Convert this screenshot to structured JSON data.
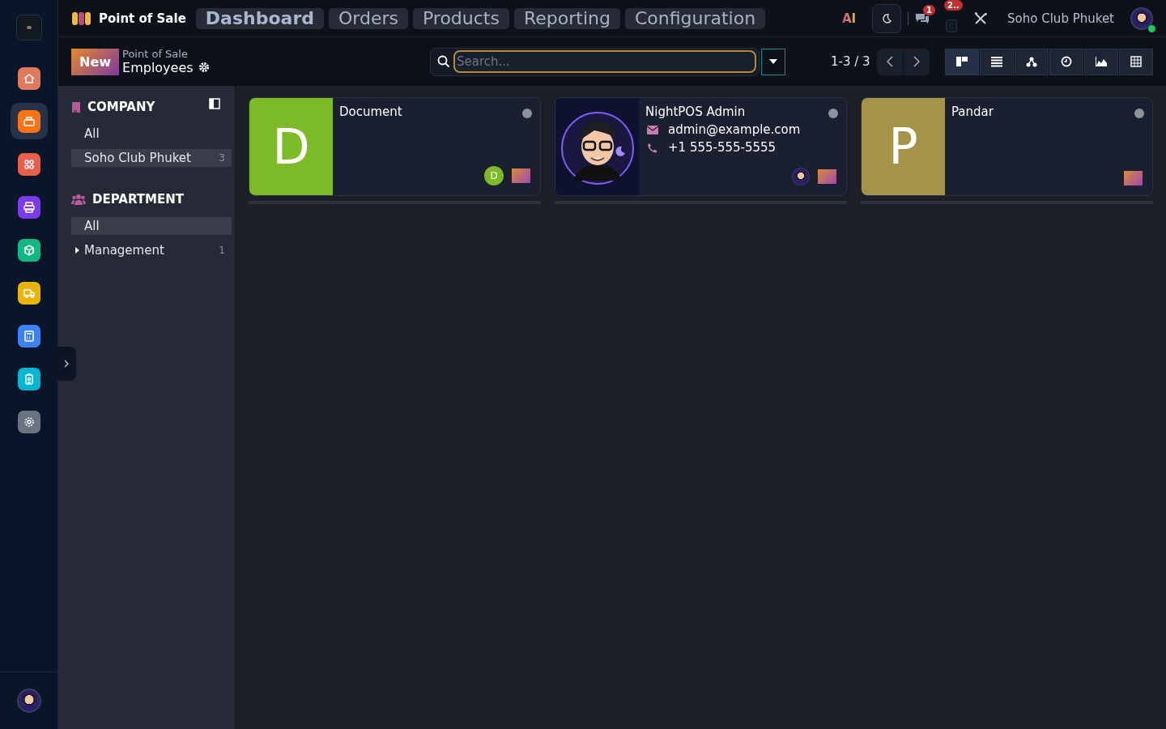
{
  "app_rail": [
    {
      "color": "#e07a5f",
      "selected": false
    },
    {
      "color": "#f97316",
      "selected": true
    },
    {
      "color": "#e8604c",
      "selected": false
    },
    {
      "color": "#7c3aed",
      "selected": false
    },
    {
      "color": "#10b981",
      "selected": false
    },
    {
      "color": "#eab308",
      "selected": false
    },
    {
      "color": "#3b82f6",
      "selected": false
    },
    {
      "color": "#06b6d4",
      "selected": false
    },
    {
      "color": "#6b7280",
      "selected": false
    }
  ],
  "top_bar": {
    "app_name": "Point of Sale",
    "menu": [
      {
        "label": "Dashboard",
        "selected": true
      },
      {
        "label": "Orders",
        "selected": false
      },
      {
        "label": "Products",
        "selected": false
      },
      {
        "label": "Reporting",
        "selected": false
      },
      {
        "label": "Configuration",
        "selected": false
      }
    ],
    "ai_label": "AI",
    "messages_badge": "1",
    "activity_badge": "2..",
    "company": "Soho Club Phuket"
  },
  "control_panel": {
    "new_button": "New",
    "breadcrumb": "Point of Sale",
    "title": "Employees",
    "search": {
      "placeholder": "Search..."
    },
    "pager": "1-3 / 3",
    "views": [
      {
        "selected": true
      },
      {
        "selected": false
      },
      {
        "selected": false
      },
      {
        "selected": false
      },
      {
        "selected": false
      },
      {
        "selected": false
      }
    ]
  },
  "filters": [
    {
      "title": "COMPANY",
      "items": [
        {
          "label": "All",
          "selected": false
        },
        {
          "label": "Soho Club Phuket",
          "count": "3",
          "selected": true
        }
      ]
    },
    {
      "title": "DEPARTMENT",
      "items": [
        {
          "label": "All",
          "selected": true
        },
        {
          "label": "Management",
          "count": "1",
          "selected": false,
          "expandable": true
        }
      ]
    }
  ],
  "cards": [
    {
      "kind": "initial",
      "initial": "D",
      "color": "#7cbb27",
      "name": "Document",
      "user_badge": "D"
    },
    {
      "kind": "photo",
      "name": "NightPOS Admin",
      "email": "admin@example.com",
      "phone": "+1 555-555-5555"
    },
    {
      "kind": "initial",
      "initial": "P",
      "color": "#a59348",
      "name": "Pandar"
    }
  ]
}
